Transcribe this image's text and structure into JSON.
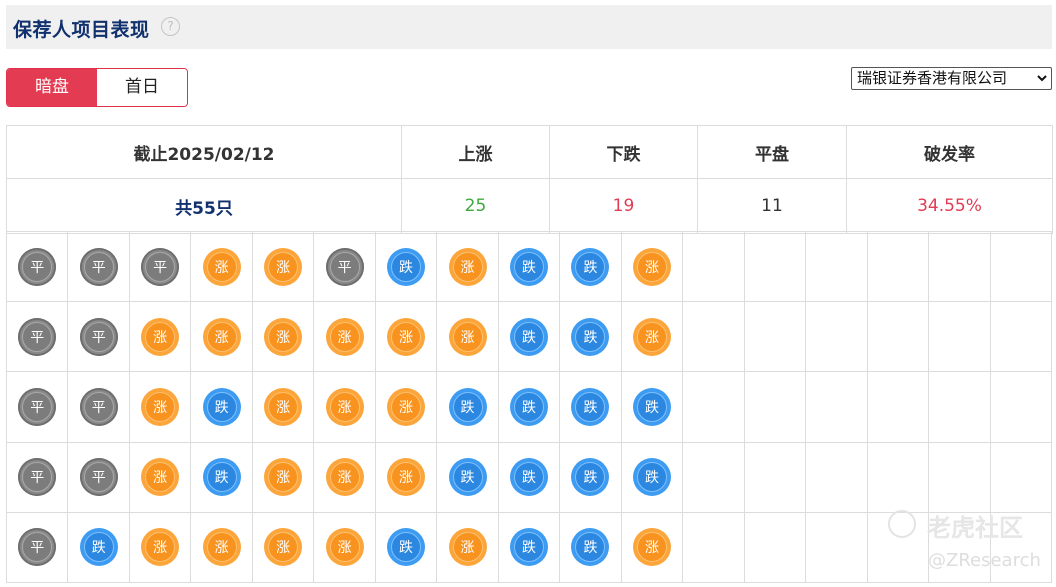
{
  "header": {
    "title": "保荐人项目表现",
    "help_glyph": "?"
  },
  "tabs": [
    {
      "label": "暗盘",
      "active": true
    },
    {
      "label": "首日",
      "active": false
    }
  ],
  "sponsor_select": {
    "selected": "瑞银证券香港有限公司"
  },
  "summary": {
    "headers": [
      "截止2025/02/12",
      "上涨",
      "下跌",
      "平盘",
      "破发率"
    ],
    "total": "共55只",
    "up": "25",
    "down": "19",
    "flat": "11",
    "break_rate": "34.55%"
  },
  "badge_labels": {
    "flat": "平",
    "up": "涨",
    "down": "跌"
  },
  "colors": {
    "up": "#3daa3a",
    "down": "#e03c52",
    "accent": "#e33c52",
    "title": "#10306e"
  },
  "grid": {
    "columns": 17,
    "rows": [
      [
        "flat",
        "flat",
        "flat",
        "up",
        "up",
        "flat",
        "down",
        "up",
        "down",
        "down",
        "up"
      ],
      [
        "flat",
        "flat",
        "up",
        "up",
        "up",
        "up",
        "up",
        "up",
        "down",
        "down",
        "up"
      ],
      [
        "flat",
        "flat",
        "up",
        "down",
        "up",
        "up",
        "up",
        "down",
        "down",
        "down",
        "down"
      ],
      [
        "flat",
        "flat",
        "up",
        "down",
        "up",
        "up",
        "up",
        "down",
        "down",
        "down",
        "down"
      ],
      [
        "flat",
        "down",
        "up",
        "up",
        "up",
        "up",
        "down",
        "up",
        "down",
        "down",
        "up"
      ]
    ]
  },
  "watermark": {
    "brand": "老虎社区",
    "handle": "@ZResearch"
  }
}
